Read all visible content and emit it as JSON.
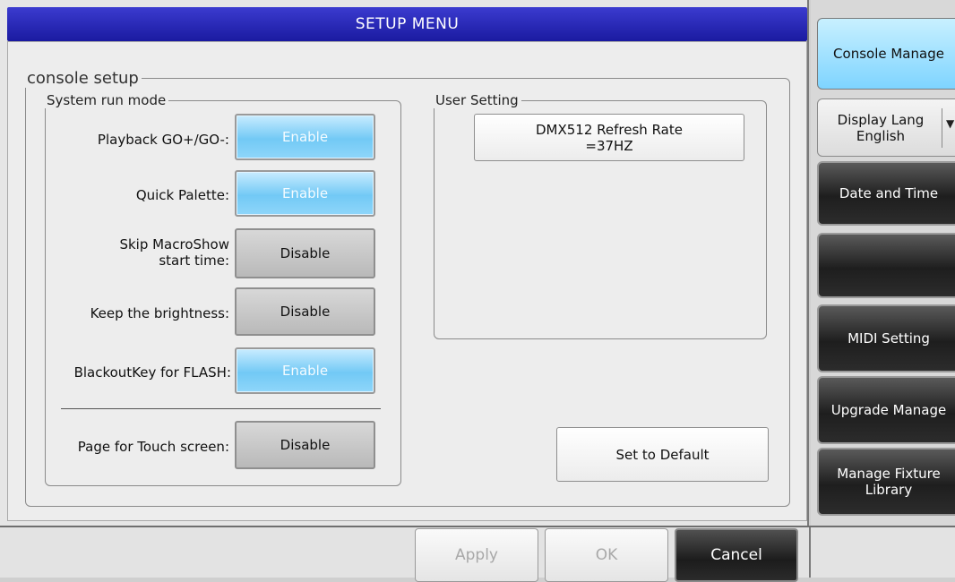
{
  "window": {
    "title": "SETUP MENU"
  },
  "console_setup": {
    "legend": "console setup",
    "system_run_mode": {
      "legend": "System run mode",
      "rows": [
        {
          "label": "Playback GO+/GO-:",
          "value": "Enable"
        },
        {
          "label": "Quick Palette:",
          "value": "Enable"
        },
        {
          "label_line1": "Skip MacroShow",
          "label_line2": "start time:",
          "value": "Disable"
        },
        {
          "label": "Keep the brightness:",
          "value": "Disable"
        },
        {
          "label": "BlackoutKey for FLASH:",
          "value": "Enable"
        },
        {
          "label": "Page for Touch screen:",
          "value": "Disable"
        }
      ]
    },
    "user_setting": {
      "legend": "User Setting",
      "dmx_line1": "DMX512 Refresh Rate",
      "dmx_line2": "=37HZ"
    },
    "set_default_label": "Set to Default"
  },
  "sidebar": {
    "console_manage": "Console Manage",
    "display_lang_line1": "Display Lang",
    "display_lang_line2": "English",
    "date_time": "Date and Time",
    "blank": "",
    "midi": "MIDI Setting",
    "upgrade": "Upgrade Manage",
    "fixture_line1": "Manage Fixture",
    "fixture_line2": "Library"
  },
  "footer": {
    "apply": "Apply",
    "ok": "OK",
    "cancel": "Cancel"
  }
}
